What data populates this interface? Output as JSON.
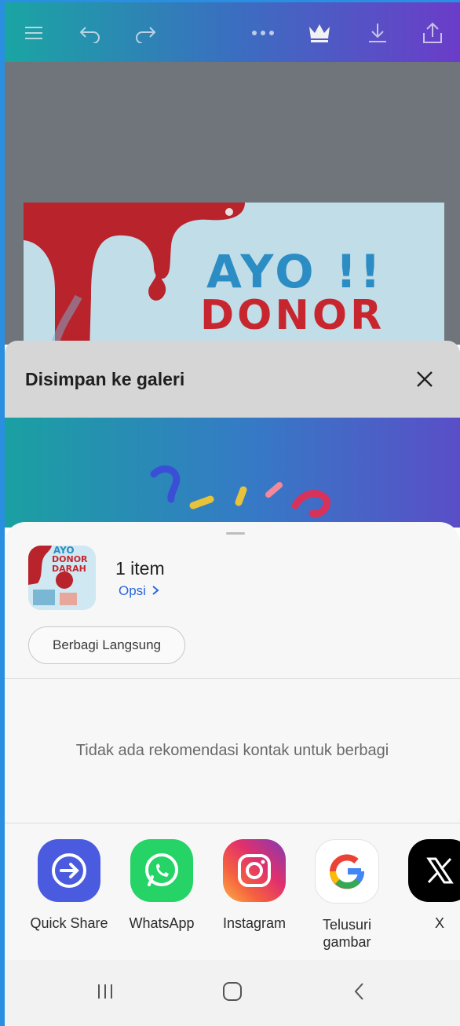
{
  "editor": {
    "icons": [
      "menu-icon",
      "undo-icon",
      "redo-icon",
      "more-icon",
      "crown-icon",
      "download-icon",
      "share-icon"
    ]
  },
  "poster": {
    "line1": "AYO !!",
    "line2": "DONOR"
  },
  "saved_panel": {
    "title": "Disimpan ke galeri",
    "close_icon": "close-icon"
  },
  "share_sheet": {
    "thumbnail": {
      "line1": "AYO",
      "line2": "DONOR",
      "line3": "DARAH"
    },
    "item_count": "1 item",
    "options_label": "Opsi",
    "direct_share_label": "Berbagi Langsung",
    "no_recommendation": "Tidak ada rekomendasi kontak untuk berbagi",
    "apps": [
      {
        "label": "Quick Share",
        "icon": "quick-share-icon",
        "color": "#4c5ee0"
      },
      {
        "label": "WhatsApp",
        "icon": "whatsapp-icon",
        "color": "#25d366"
      },
      {
        "label": "Instagram",
        "icon": "instagram-icon",
        "color": "#e1306c"
      },
      {
        "label": "Telusuri\ngambar",
        "icon": "google-icon",
        "color": "#ffffff"
      },
      {
        "label": "X",
        "icon": "x-icon",
        "color": "#000000"
      }
    ]
  },
  "navbar": {
    "icons": [
      "recent-apps-icon",
      "home-icon",
      "back-icon"
    ]
  },
  "colors": {
    "accent_link": "#2b66d9",
    "header_gradient_start": "#1aa5a3",
    "header_gradient_end": "#6b3cc9"
  }
}
